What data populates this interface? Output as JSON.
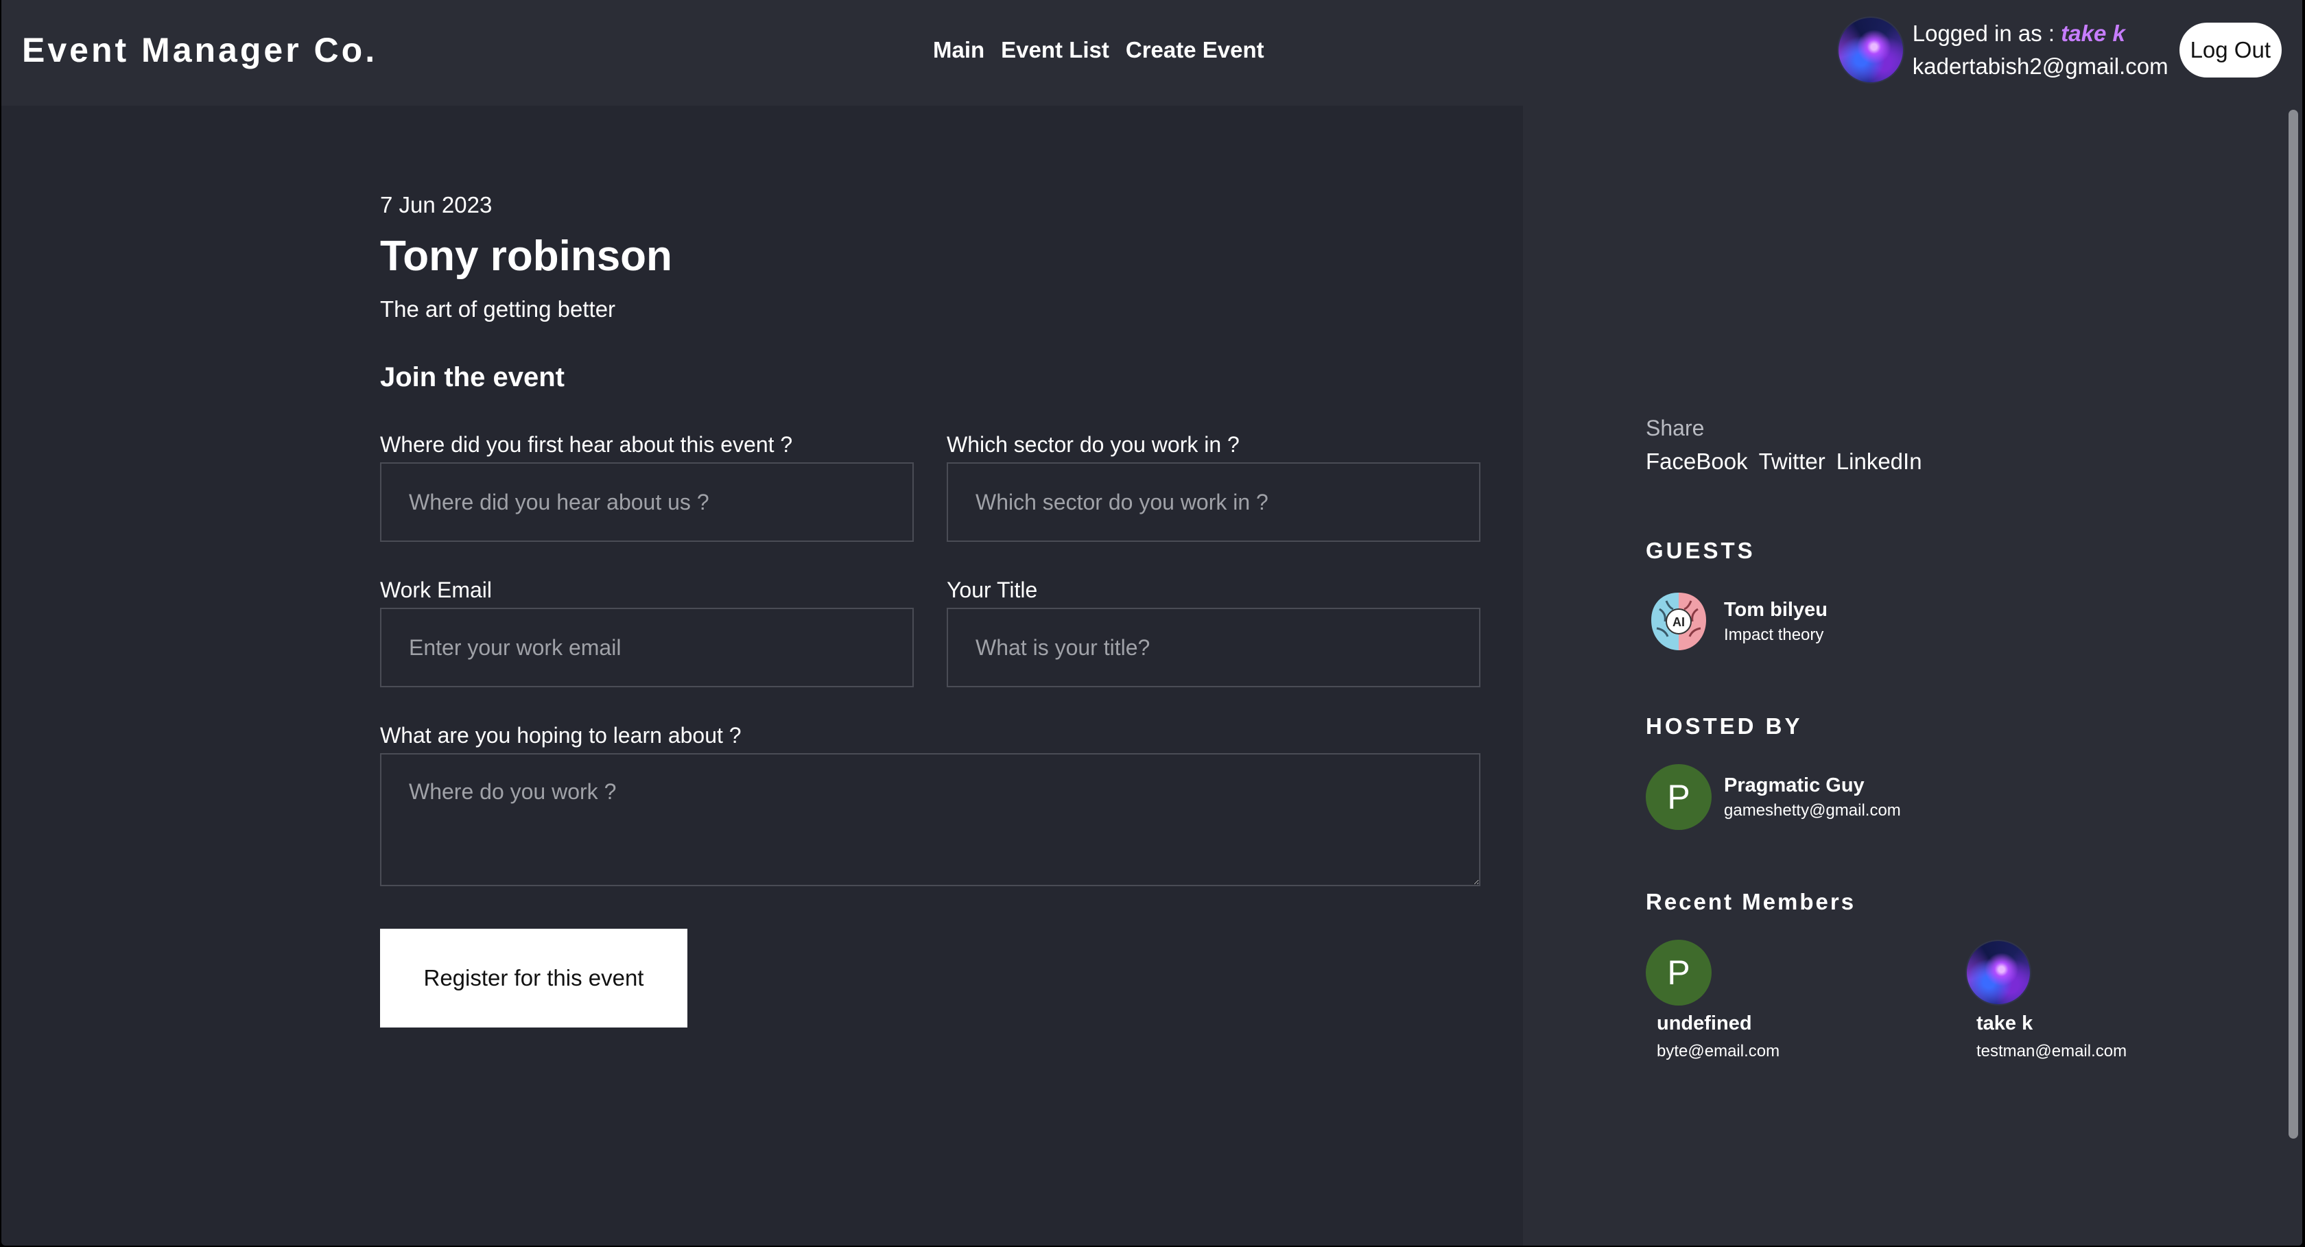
{
  "header": {
    "brand": "Event Manager Co.",
    "nav": [
      "Main",
      "Event List",
      "Create Event"
    ],
    "logged_in_prefix": "Logged in as :",
    "username": "take k",
    "email": "kadertabish2@gmail.com",
    "logout_label": "Log Out"
  },
  "event": {
    "date": "7 Jun 2023",
    "title": "Tony robinson",
    "subtitle": "The art of getting better",
    "join_heading": "Join the event"
  },
  "form": {
    "hear_label": "Where did you first hear about this event ?",
    "hear_placeholder": "Where did you hear about us ?",
    "sector_label": "Which sector do you work in ?",
    "sector_placeholder": "Which sector do you work in ?",
    "email_label": "Work Email",
    "email_placeholder": "Enter your work email",
    "title_label": "Your Title",
    "title_placeholder": "What is your title?",
    "learn_label": "What are you hoping to learn about ?",
    "learn_placeholder": "Where do you work ?",
    "register_label": "Register for this event"
  },
  "sidebar": {
    "share_label": "Share",
    "share_links": [
      "FaceBook",
      "Twitter",
      "LinkedIn"
    ],
    "guests_title": "GUESTS",
    "guest": {
      "name": "Tom bilyeu",
      "org": "Impact theory",
      "avatar_text": "AI"
    },
    "hosted_title": "HOSTED BY",
    "host": {
      "initial": "P",
      "name": "Pragmatic Guy",
      "email": "gameshetty@gmail.com"
    },
    "members_title": "Recent Members",
    "members": [
      {
        "initial": "P",
        "name": "undefined",
        "email": "byte@email.com"
      },
      {
        "name": "take k",
        "email": "testman@email.com"
      }
    ]
  },
  "colors": {
    "background": "#252730",
    "panel": "#2b2d36",
    "accent_user": "#c77dff",
    "avatar_green": "#3f6b2c"
  }
}
